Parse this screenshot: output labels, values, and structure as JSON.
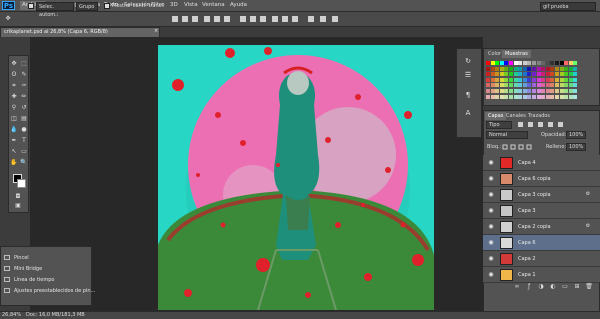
{
  "menu": {
    "app_icon": "Ps",
    "items": [
      "Archivo",
      "Edición",
      "Imagen",
      "Capa",
      "Texto",
      "Selección",
      "Filtro",
      "3D",
      "Vista",
      "Ventana",
      "Ayuda"
    ],
    "window_buttons": [
      "–",
      "□",
      "✕"
    ]
  },
  "options": {
    "tool_select_value": "Selec. autom.:",
    "group_select_value": "Grupo",
    "show_transform_label": "Mostrar contr. transf.",
    "workspace_select_value": "gif prueba"
  },
  "document": {
    "tab_title": "crikaplanet.psd al 26,8% (Capa 6, RGB/8)",
    "close_label": "×"
  },
  "tools": {
    "icons": [
      "move-icon",
      "marquee-icon",
      "lasso-icon",
      "quick-select-icon",
      "crop-icon",
      "eyedropper-icon",
      "healing-icon",
      "brush-icon",
      "stamp-icon",
      "history-brush-icon",
      "eraser-icon",
      "gradient-icon",
      "blur-icon",
      "dodge-icon",
      "pen-icon",
      "type-icon",
      "path-select-icon",
      "shape-icon",
      "hand-icon",
      "zoom-icon"
    ],
    "glyphs": [
      "✥",
      "⬚",
      "ʘ",
      "✎",
      "⌗",
      "✑",
      "✚",
      "✏",
      "⚲",
      "↺",
      "◫",
      "▤",
      "💧",
      "●",
      "✒",
      "T",
      "↖",
      "▭",
      "✋",
      "🔍"
    ]
  },
  "bottom_panel": {
    "items": [
      "Pincel",
      "Mini Bridge",
      "Línea de tiempo",
      "Ajustes preestablecidos de pin..."
    ]
  },
  "status": {
    "zoom": "26,84%",
    "doc_info": "Doc: 16,0 MB/181,3 MB"
  },
  "swatches_panel": {
    "tabs": [
      "Color",
      "Muestras"
    ],
    "active_tab": "Muestras"
  },
  "layers_panel": {
    "tabs": [
      "Capas",
      "Canales",
      "Trazados"
    ],
    "active_tab": "Capas",
    "kind_filter": "Tipo",
    "blend_mode": "Normal",
    "opacity_label": "Opacidad:",
    "opacity_value": "100%",
    "lock_label": "Bloq.:",
    "fill_label": "Relleno:",
    "fill_value": "100%",
    "layers": [
      {
        "name": "Capa 4",
        "thumb": "#e32828",
        "fx": false,
        "selected": false
      },
      {
        "name": "Capa 6 copia",
        "thumb": "#d98a6a",
        "fx": false,
        "selected": false
      },
      {
        "name": "Capa 3 copia",
        "thumb": "#c9c9c9",
        "fx": true,
        "selected": false
      },
      {
        "name": "Capa 3",
        "thumb": "#c6c6c6",
        "fx": false,
        "selected": false
      },
      {
        "name": "Capa 2 copia",
        "thumb": "#cfcfcf",
        "fx": true,
        "selected": false
      },
      {
        "name": "Capa 6",
        "thumb": "#d9d9d9",
        "fx": false,
        "selected": true
      },
      {
        "name": "Capa 2",
        "thumb": "#d23a3a",
        "fx": false,
        "selected": false
      },
      {
        "name": "Capa 1",
        "thumb": "#f0b64a",
        "fx": false,
        "selected": false
      }
    ],
    "footer_icons": [
      "link-icon",
      "fx-icon",
      "mask-icon",
      "adjustment-icon",
      "folder-icon",
      "new-layer-icon",
      "trash-icon"
    ]
  },
  "colors": {
    "canvas_bg": "#25d2c0",
    "moon": "#ec6fb4",
    "planet": "#3b8a3a",
    "selected_layer": "#5d6f8a"
  }
}
